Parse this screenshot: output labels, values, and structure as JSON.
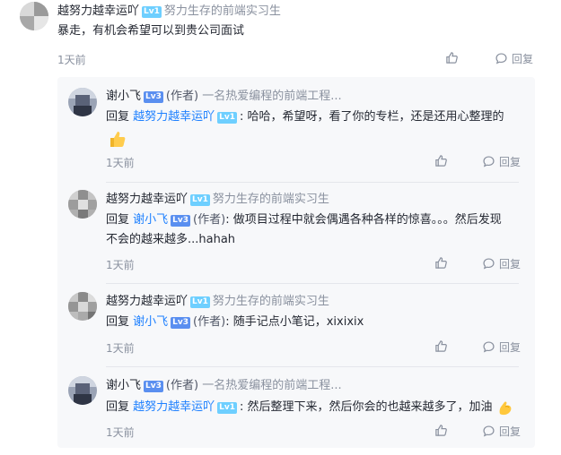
{
  "comment": {
    "author": "越努力越幸运吖",
    "level": "Lv1",
    "bio": "努力生存的前端实习生",
    "text": "暴走，有机会希望可以到贵公司面试",
    "time": "1天前",
    "reply_label": "回复"
  },
  "replies": [
    {
      "author": "谢小飞",
      "level": "Lv3",
      "author_tag": "(作者)",
      "bio": "一名热爱编程的前端工程...",
      "reply_label": "回复",
      "target": "越努力越幸运吖",
      "target_level": "Lv1",
      "line1": ": 哈哈，希望呀，看了你的专栏，还是还用心整理的",
      "line2": "",
      "emoji": "thumbs-up",
      "time": "1天前",
      "action_reply": "回复"
    },
    {
      "author": "越努力越幸运吖",
      "level": "Lv1",
      "author_tag": "",
      "bio": "努力生存的前端实习生",
      "reply_label": "回复",
      "target": "谢小飞",
      "target_level": "Lv3",
      "target_tag": "(作者)",
      "line1": ": 做项目过程中就会偶遇各种各样的惊喜。。。然后发现",
      "line2": "不会的越来越多...hahah",
      "time": "1天前",
      "action_reply": "回复"
    },
    {
      "author": "越努力越幸运吖",
      "level": "Lv1",
      "author_tag": "",
      "bio": "努力生存的前端实习生",
      "reply_label": "回复",
      "target": "谢小飞",
      "target_level": "Lv3",
      "target_tag": "(作者)",
      "line1": ": 随手记点小笔记，xixixix",
      "time": "1天前",
      "action_reply": "回复"
    },
    {
      "author": "谢小飞",
      "level": "Lv3",
      "author_tag": "(作者)",
      "bio": "一名热爱编程的前端工程...",
      "reply_label": "回复",
      "target": "越努力越幸运吖",
      "target_level": "Lv1",
      "line1": ": 然后整理下来，然后你会的也越来越多了，加油",
      "emoji": "flexed-biceps",
      "time": "1天前",
      "action_reply": "回复"
    }
  ],
  "colors": {
    "link": "#1e80ff",
    "muted": "#8a919f",
    "lv1": "#6ecfff",
    "lv3": "#5a8ff0",
    "reply_bg": "#f7f8fa"
  }
}
